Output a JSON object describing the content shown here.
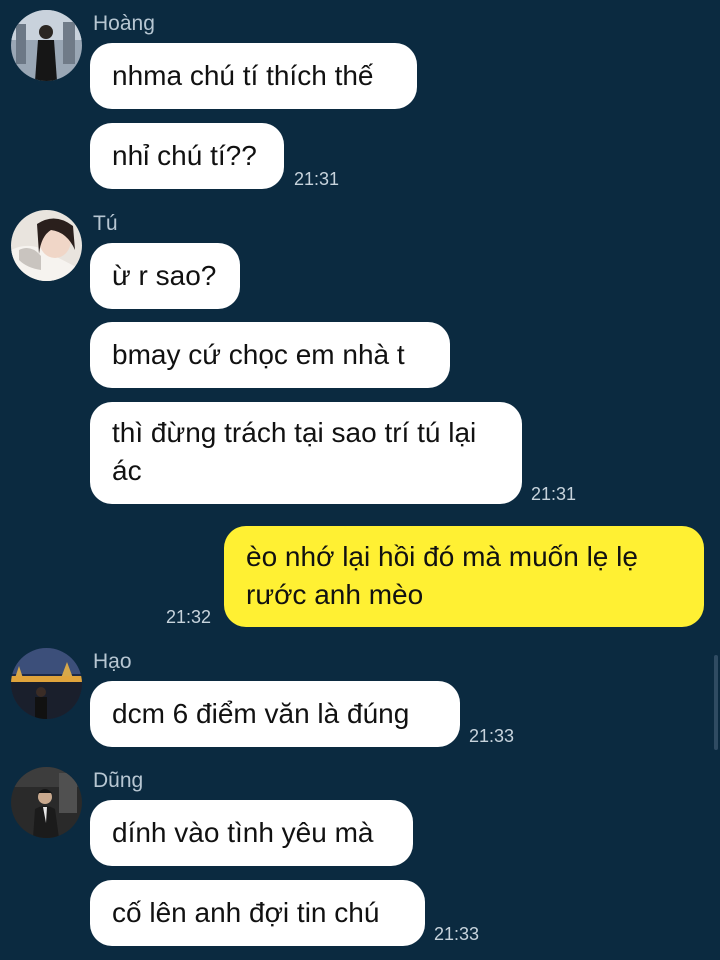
{
  "colors": {
    "background": "#0b2a40",
    "incoming_bubble": "#ffffff",
    "outgoing_bubble": "#fff033",
    "sender_name": "#b7c6d2",
    "timestamp": "#c7d3dc"
  },
  "groups": [
    {
      "sender": "Hoàng",
      "avatar": "avatar-hoang",
      "messages": [
        "nhma chú tí thích thế",
        "nhỉ chú tí??"
      ],
      "time": "21:31"
    },
    {
      "sender": "Tú",
      "avatar": "avatar-tu",
      "messages": [
        "ừ r sao?",
        "bmay cứ chọc em nhà t",
        "thì đừng trách tại sao trí tú lại ác"
      ],
      "time": "21:31"
    },
    {
      "sender": "",
      "outgoing": true,
      "messages": [
        "èo nhớ lại hồi đó mà muốn lẹ lẹ rước anh mèo"
      ],
      "time": "21:32"
    },
    {
      "sender": "Hạo",
      "avatar": "avatar-hao",
      "messages": [
        "dcm 6 điểm văn là đúng"
      ],
      "time": "21:33"
    },
    {
      "sender": "Dũng",
      "avatar": "avatar-dung",
      "messages": [
        "dính vào tình yêu mà",
        "cố lên anh đợi tin chú"
      ],
      "time": "21:33"
    }
  ]
}
